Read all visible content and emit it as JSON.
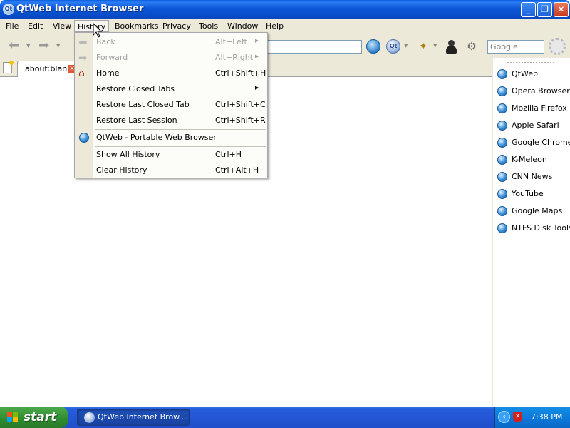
{
  "window": {
    "title": "QtWeb Internet Browser",
    "icon": "qtweb-icon",
    "controls": [
      "minimize-icon",
      "maximize-icon",
      "close-icon"
    ]
  },
  "menubar": {
    "items": [
      "File",
      "Edit",
      "View",
      "History",
      "Bookmarks",
      "Privacy",
      "Tools",
      "Window",
      "Help"
    ],
    "active": "History"
  },
  "toolbar": {
    "icons": [
      "back-icon",
      "forward-icon",
      "home-icon",
      "reload-icon",
      "qtweb-menu-icon",
      "wand-icon",
      "user-icon",
      "gears-icon",
      "settings-icon"
    ],
    "url_value": "",
    "search_placeholder": "Google"
  },
  "tabs": [
    {
      "label": "about:blank",
      "active": true
    }
  ],
  "history_menu": {
    "items": [
      {
        "label": "Back",
        "shortcut": "Alt+Left",
        "submenu": true,
        "enabled": false,
        "icon": "back-arrow-icon"
      },
      {
        "label": "Forward",
        "shortcut": "Alt+Right",
        "submenu": true,
        "enabled": false,
        "icon": "forward-arrow-icon"
      },
      {
        "label": "Home",
        "shortcut": "Ctrl+Shift+H",
        "submenu": false,
        "enabled": true,
        "icon": "home-icon"
      },
      {
        "label": "Restore Closed Tabs",
        "shortcut": "",
        "submenu": true,
        "enabled": true
      },
      {
        "label": "Restore Last Closed Tab",
        "shortcut": "Ctrl+Shift+C",
        "submenu": false,
        "enabled": true
      },
      {
        "label": "Restore Last Session",
        "shortcut": "Ctrl+Shift+R",
        "submenu": false,
        "enabled": true
      },
      {
        "label": "QtWeb - Portable Web Browser",
        "shortcut": "",
        "submenu": false,
        "enabled": true,
        "icon": "globe-icon"
      },
      {
        "label": "Show All History",
        "shortcut": "Ctrl+H",
        "submenu": false,
        "enabled": true
      },
      {
        "label": "Clear History",
        "shortcut": "Ctrl+Alt+H",
        "submenu": false,
        "enabled": true
      }
    ]
  },
  "bookmarks": [
    "QtWeb",
    "Opera Browser",
    "Mozilla Firefox",
    "Apple Safari",
    "Google Chrome",
    "K-Meleon",
    "CNN News",
    "YouTube",
    "Google Maps",
    "NTFS Disk Tools"
  ],
  "taskbar": {
    "start_label": "start",
    "task_label": "QtWeb Internet Brow...",
    "clock": "7:38 PM"
  },
  "colors": {
    "titlebar": "#0a58d8",
    "chrome": "#ece9d8",
    "taskbar": "#245edb",
    "start": "#2e8b2e"
  }
}
